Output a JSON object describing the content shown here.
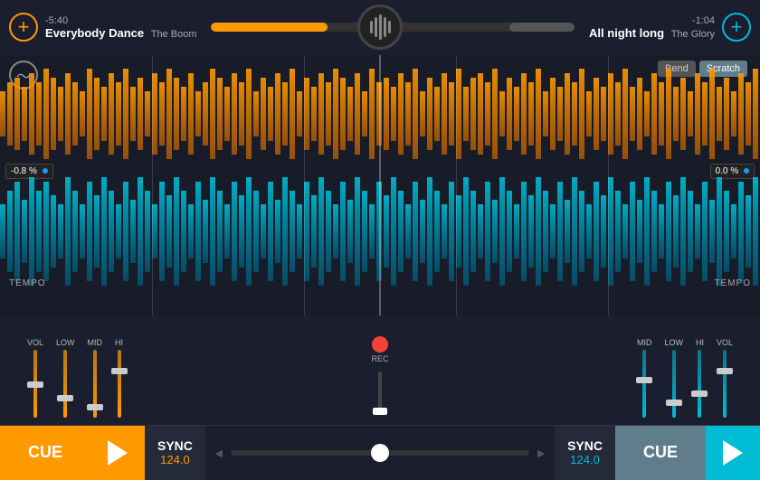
{
  "header": {
    "add_left_label": "+",
    "add_right_label": "+",
    "left_time": "-5:40",
    "left_title": "Everybody Dance",
    "left_artist": "The Boom",
    "right_time": "-1:04",
    "right_title": "All night long",
    "right_artist": "The Glory",
    "left_progress": 72,
    "right_progress": 35
  },
  "waveform": {
    "bend_label": "Bend",
    "scratch_label": "Scratch",
    "pitch_left": "-0.8 %",
    "pitch_right": "0.0 %",
    "tempo_label": "TEMPO"
  },
  "mixer": {
    "rec_label": "REC",
    "left_faders": [
      {
        "label": "VOL"
      },
      {
        "label": "LOW"
      },
      {
        "label": "MID"
      },
      {
        "label": "HI"
      }
    ],
    "right_faders": [
      {
        "label": "MID"
      },
      {
        "label": "LOW"
      },
      {
        "label": "HI"
      },
      {
        "label": "VOL"
      }
    ]
  },
  "transport": {
    "cue_left": "CUE",
    "cue_right": "CUE",
    "sync_left_label": "SYNC",
    "sync_left_bpm": "124.0",
    "sync_right_label": "SYNC",
    "sync_right_bpm": "124.0",
    "cf_arrow_left": "◄",
    "cf_arrow_right": "►"
  }
}
